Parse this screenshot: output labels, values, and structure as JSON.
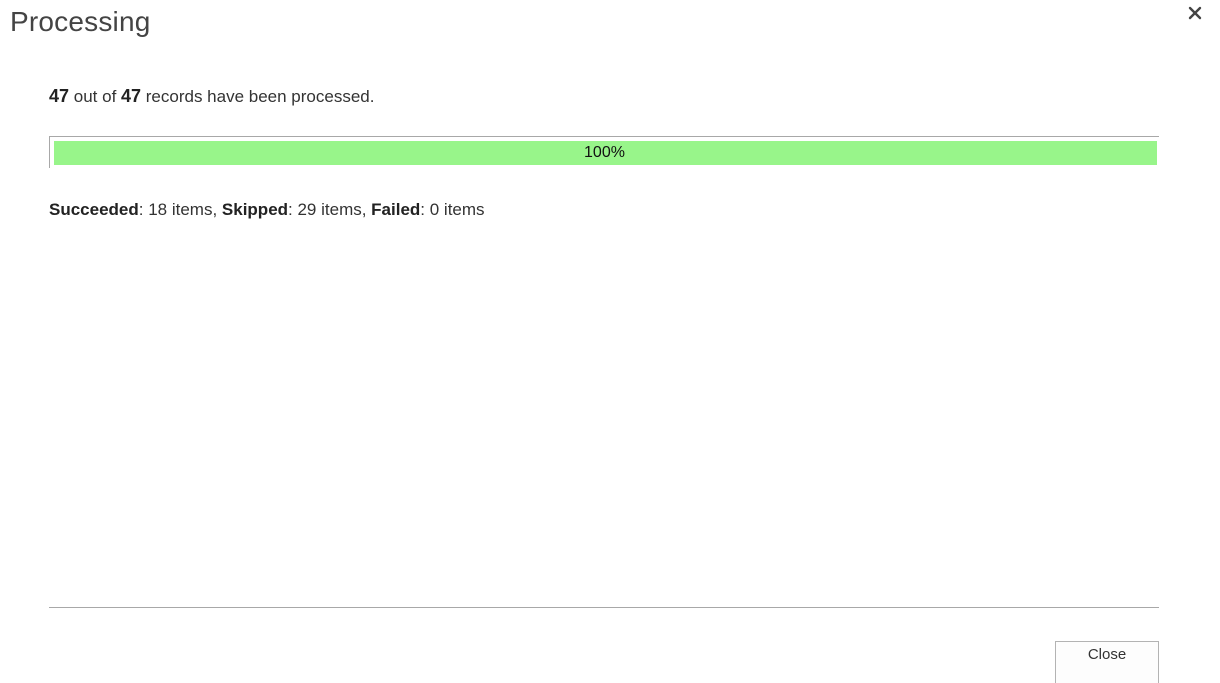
{
  "dialog": {
    "title": "Processing",
    "close_icon": "close-icon"
  },
  "summary": {
    "processed": "47",
    "out_of_text": " out of ",
    "total": "47",
    "suffix": " records have been processed."
  },
  "progress": {
    "percent": 100,
    "label": "100%",
    "fill_color": "#98f58a"
  },
  "results": {
    "succeeded_label": "Succeeded",
    "succeeded_value": ": 18 items, ",
    "skipped_label": "Skipped",
    "skipped_value": ": 29 items, ",
    "failed_label": "Failed",
    "failed_value": ": 0 items"
  },
  "footer": {
    "close_label": "Close"
  }
}
